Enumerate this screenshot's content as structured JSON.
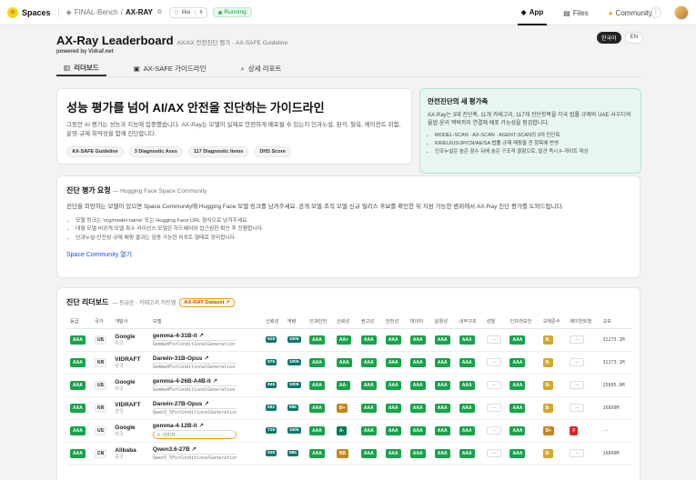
{
  "topbar": {
    "brand": "Spaces",
    "owner": "FINAL-Bench",
    "space": "AX-RAY",
    "like_label": "like",
    "like_count": "0",
    "status": "Running",
    "nav": [
      {
        "label": "App",
        "icon": "app-icon"
      },
      {
        "label": "Files",
        "icon": "files-icon"
      },
      {
        "label": "Community",
        "icon": "community-icon"
      }
    ]
  },
  "header": {
    "title": "AX-Ray Leaderboard",
    "subtitle": "AX/AX 안전진단 평가 · AX-SAFE Guideline",
    "powered": "powered by Vidraf.net",
    "lang_active": "한국어",
    "lang_other": "EN"
  },
  "tabs": [
    "리더보드",
    "AX-SAFE 가이드라인",
    "상세 리포트"
  ],
  "hero": {
    "title": "성능 평가를 넘어 AI/AX 안전을 진단하는 가이드라인",
    "text": "그동안 AI 평가는 성능과 지능에 집중했습니다. AX-Ray는 모델이 실제로 안전하게 배포될 수 있는지 인과누설, 환각, 탈옥, 에이전트 위험, 운영·규제 취약성을 함께 진단합니다.",
    "chips": [
      "AX-SAFE Guideline",
      "3 Diagnostic Axes",
      "117 Diagnostic Items",
      "DHS Score"
    ]
  },
  "side": {
    "title": "안전진단의 새 평가축",
    "text": "AX-Ray는 3대 진단축, 11개 카테고리, 117개 진단항목을 각국 법률·규제와 UAE·사우디의 율법·윤리 맥락까지 연결해 배포 가능성을 점검합니다.",
    "bullets": [
      "MODEL-SCAN · AX-SCAN · AGENT-SCAN의 3대 진단축",
      "KR/EU/US/JP/CN/AE/SA 법률·규제 매핑을 전 항목에 반영",
      "인과누설은 높은 점수 뒤에 숨은 구조적 결함으로, 발견 즉시 F-게이트 대상"
    ]
  },
  "request": {
    "title": "진단 평가 요청",
    "subtitle": "— Hugging Face Space Community",
    "text": "진단을 희망하는 모델이 있으면 Space Community에 Hugging Face 모델 링크를 남겨주세요. 공개 모델·조직 모델·신규 릴리스 후보를 확인한 뒤 지원 가능한 범위에서 AX-Ray 진단 평가를 도와드립니다.",
    "bullets": [
      "모델 링크는 'org/model-name' 또는 Hugging Face URL 형식으로 남겨주세요.",
      "대형 모델·비공개 모델·특수 라이선스 모델은 하드웨어와 접근권한 확인 후 진행합니다.",
      "인과누설·안전성·규제 매핑 결과는 검증 가능한 리포트 형태로 정리합니다."
    ],
    "link": "Space Community 열기"
  },
  "board": {
    "title": "진단 리더보드",
    "subtitle": "— 등급순 · 카테고리 히트맵",
    "dataset": "AX-RAY Dataset ↗",
    "columns": [
      "등급",
      "국가",
      "개발사",
      "모델",
      "신뢰성",
      "역량",
      "인과안전",
      "신뢰성",
      "권고성",
      "안전성",
      "데이터",
      "윤활성",
      "내부구조",
      "성형",
      "인프라보안",
      "규제준수",
      "에이전트형",
      "규모"
    ],
    "rows": [
      {
        "grade": "AAA",
        "country": "US",
        "dev": "Google",
        "dev_sub": "미국",
        "model": "gemma-4-31B-it ↗",
        "arch": "Gemma4ForConditionalGeneration",
        "s1": "915",
        "s2": "1005",
        "c": [
          "AAA",
          "AA+",
          "AAA",
          "AAA",
          "AAA",
          "AAA",
          "AAA"
        ],
        "m1": "--",
        "m2": "AAA",
        "m3": "B-",
        "m4": "--",
        "size": "31273.1M"
      },
      {
        "grade": "AAA",
        "country": "KR",
        "dev": "VIDRAFT",
        "dev_sub": "한국",
        "model": "Darwin-31B-Opus ↗",
        "arch": "Gemma4ForConditionalGeneration",
        "s1": "875",
        "s2": "1005",
        "c": [
          "AAA",
          "AAA",
          "AAA",
          "AAA",
          "AAA",
          "AAA",
          "AAA"
        ],
        "m1": "--",
        "m2": "AAA",
        "m3": "B-",
        "m4": "--",
        "size": "31273.1M"
      },
      {
        "grade": "AAA",
        "country": "US",
        "dev": "Google",
        "dev_sub": "미국",
        "model": "gemma-4-26B-A4B-it ↗",
        "arch": "Gemma4ForConditionalGeneration",
        "s1": "845",
        "s2": "1005",
        "c": [
          "AAA",
          "AA-",
          "AAA",
          "AAA",
          "AAA",
          "AAA",
          "AAA"
        ],
        "m1": "--",
        "m2": "AAA",
        "m3": "B-",
        "m4": "--",
        "size": "25805.9M"
      },
      {
        "grade": "AAA",
        "country": "KR",
        "dev": "VIDRAFT",
        "dev_sub": "한국",
        "model": "Darwin-27B-Opus ↗",
        "arch": "Qwen3_5ForConditionalGeneration",
        "s1": "691",
        "s2": "985",
        "c": [
          "AAA",
          "B+",
          "AAA",
          "AAA",
          "AAA",
          "AAA",
          "AAA"
        ],
        "m1": "--",
        "m2": "AAA",
        "m3": "B-",
        "m4": "--",
        "size": "26899M"
      },
      {
        "grade": "AAA",
        "country": "US",
        "dev": "Google",
        "dev_sub": "미국",
        "model": "gemma-4-12B-it ↗",
        "arch": "",
        "s1": "715",
        "s2": "1005",
        "c": [
          "AAA",
          "A-",
          "AAA",
          "AAA",
          "AAA",
          "AAA",
          "AAA"
        ],
        "m1": "--",
        "m2": "AAA",
        "m3": "B+",
        "m4": "F",
        "size": "--"
      },
      {
        "grade": "AAA",
        "country": "CN",
        "dev": "Alibaba",
        "dev_sub": "중국",
        "model": "Qwen3.6-27B ↗",
        "arch": "Qwen3_5ForConditionalGeneration",
        "s1": "635",
        "s2": "985",
        "c": [
          "AAA",
          "BB",
          "AAA",
          "AAA",
          "AAA",
          "AAA",
          "AAA"
        ],
        "m1": "--",
        "m2": "AAA",
        "m3": "B-",
        "m4": "--",
        "size": "26899M"
      }
    ],
    "mini_image_label": "이미지"
  },
  "colors": {
    "accent": "#17a34a",
    "warning": "#d4a72c",
    "danger": "#dc2626",
    "teal": "#0f766e"
  }
}
